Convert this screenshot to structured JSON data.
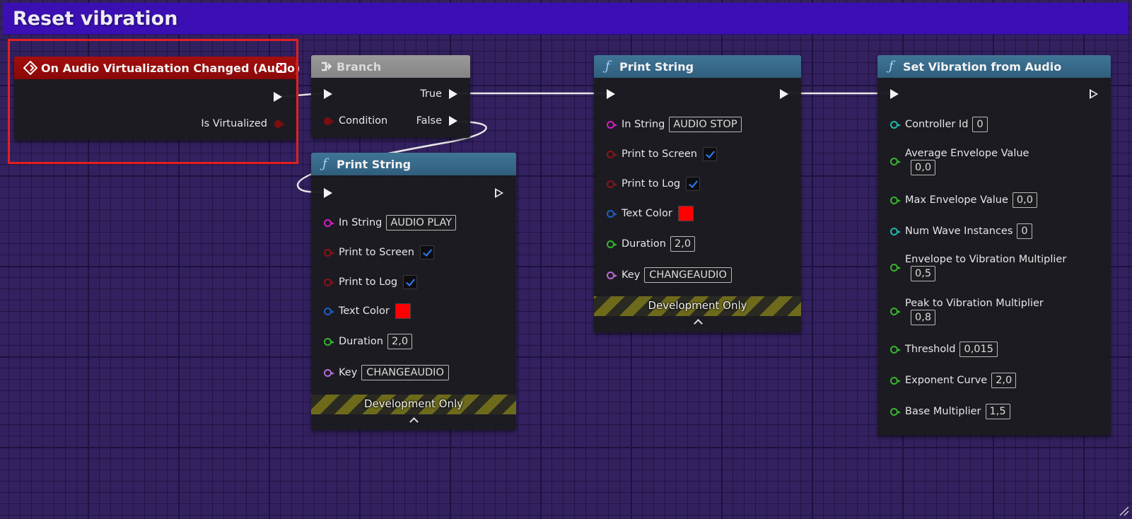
{
  "graph_title": "Reset vibration",
  "event_node": {
    "title": "On Audio Virtualization Changed (Audio)",
    "pins": {
      "is_virtualized": "Is Virtualized"
    }
  },
  "branch_node": {
    "title": "Branch",
    "pins": {
      "condition": "Condition",
      "true": "True",
      "false": "False"
    }
  },
  "print_play": {
    "title": "Print String",
    "in_string_label": "In String",
    "in_string_value": "AUDIO PLAY",
    "print_to_screen_label": "Print to Screen",
    "print_to_screen": true,
    "print_to_log_label": "Print to Log",
    "print_to_log": true,
    "text_color_label": "Text Color",
    "text_color": "#ff0000",
    "duration_label": "Duration",
    "duration_value": "2,0",
    "key_label": "Key",
    "key_value": "CHANGEAUDIO",
    "dev_only": "Development Only"
  },
  "print_stop": {
    "title": "Print String",
    "in_string_label": "In String",
    "in_string_value": "AUDIO STOP",
    "print_to_screen_label": "Print to Screen",
    "print_to_screen": true,
    "print_to_log_label": "Print to Log",
    "print_to_log": true,
    "text_color_label": "Text Color",
    "text_color": "#ff0000",
    "duration_label": "Duration",
    "duration_value": "2,0",
    "key_label": "Key",
    "key_value": "CHANGEAUDIO",
    "dev_only": "Development Only"
  },
  "set_vibration": {
    "title": "Set Vibration from Audio",
    "params": [
      {
        "label": "Controller Id",
        "value": "0"
      },
      {
        "label": "Average Envelope Value",
        "value": "0,0"
      },
      {
        "label": "Max Envelope Value",
        "value": "0,0"
      },
      {
        "label": "Num Wave Instances",
        "value": "0"
      },
      {
        "label": "Envelope to Vibration Multiplier",
        "value": "0,5"
      },
      {
        "label": "Peak to Vibration Multiplier",
        "value": "0,8"
      },
      {
        "label": "Threshold",
        "value": "0,015"
      },
      {
        "label": "Exponent Curve",
        "value": "2,0"
      },
      {
        "label": "Base Multiplier",
        "value": "1,5"
      }
    ]
  },
  "pin_colors": {
    "exec": "#f3f3f3",
    "bool": "#8a1418",
    "string": "#d31fc4",
    "linear_color": "#1f5fc4",
    "float": "#36b52d",
    "name": "#b66bd6",
    "int": "#20b8a8"
  },
  "selection_color": "#e02020"
}
